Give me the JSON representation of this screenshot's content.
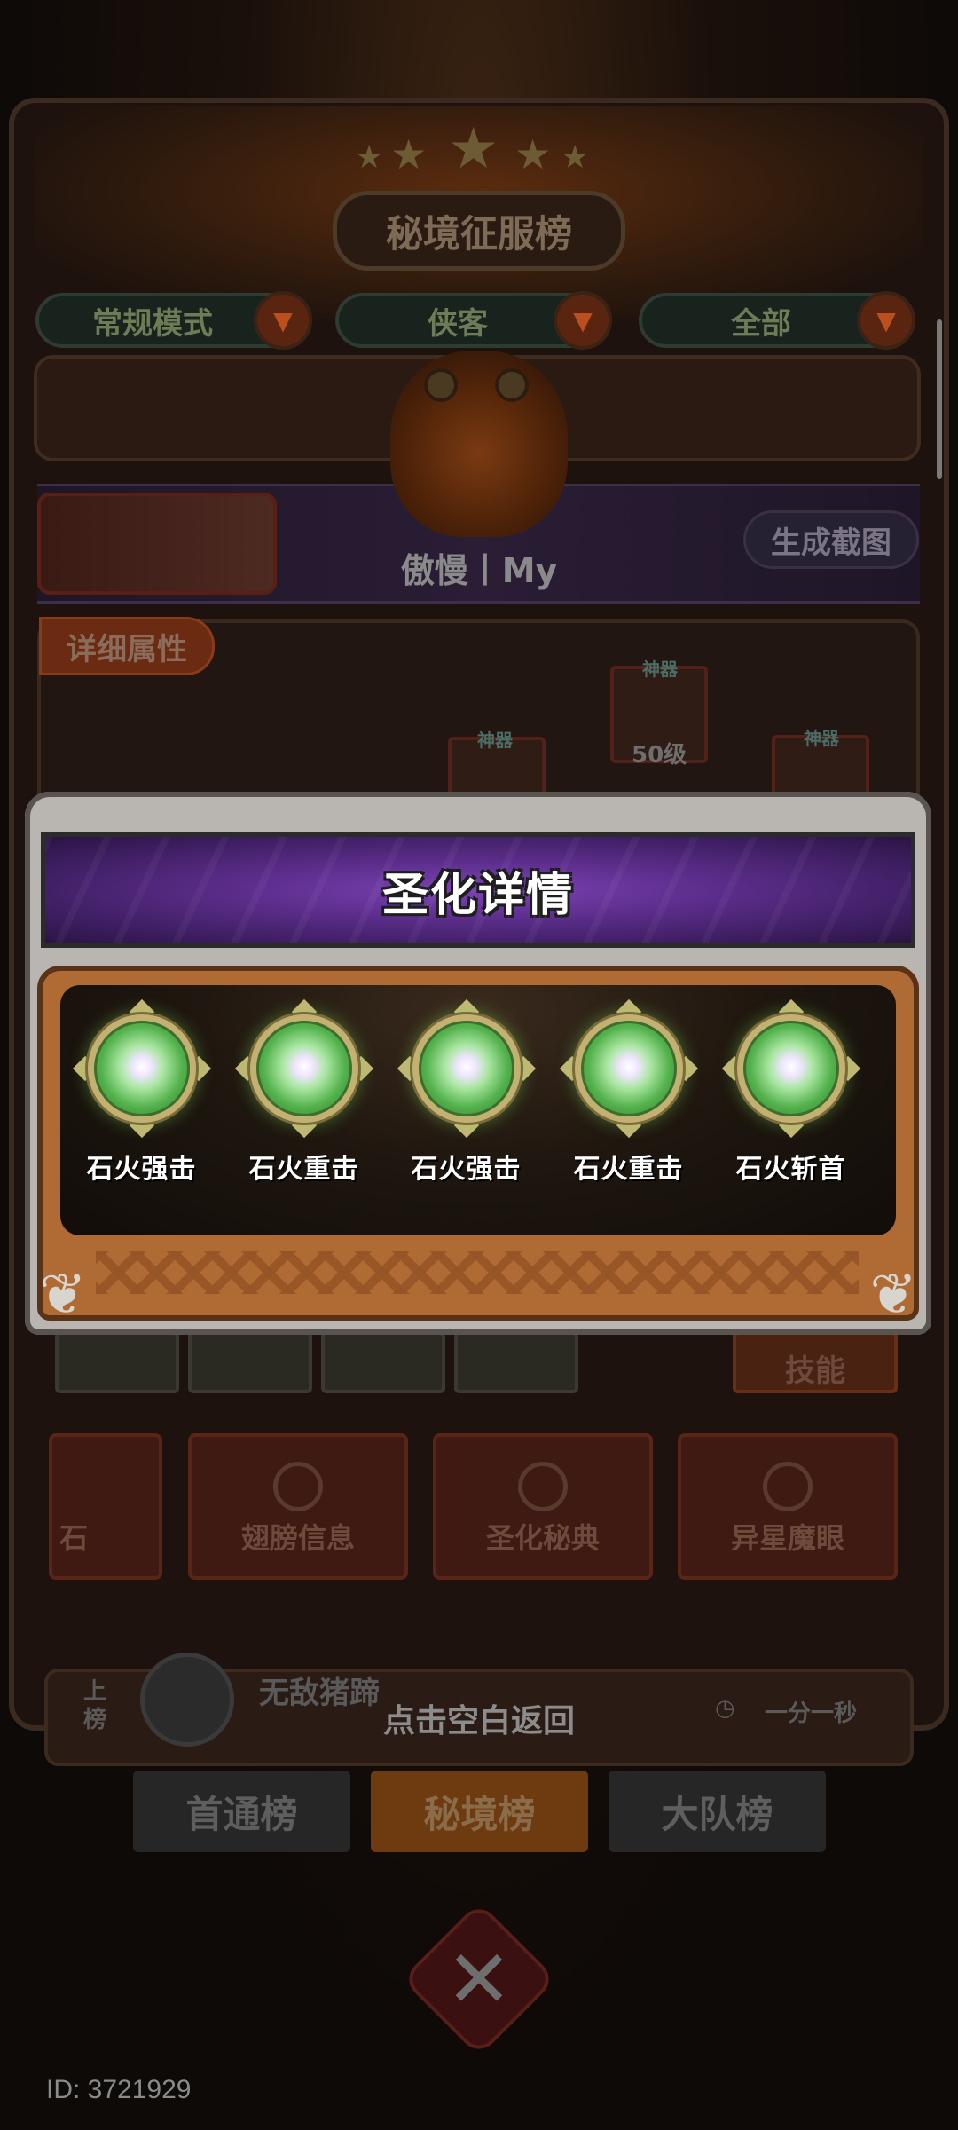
{
  "background": {
    "title": "秘境征服榜",
    "filters": [
      {
        "label": "常规模式"
      },
      {
        "label": "侠客"
      },
      {
        "label": "全部"
      }
    ],
    "player_name": "傲慢丨My",
    "screenshot_button": "生成截图",
    "detail_tab": "详细属性",
    "equip_tag": "神器",
    "equip_level": "50级",
    "menu_partial": "石",
    "menu_buttons": [
      "翅膀信息",
      "圣化秘典",
      "异星魔眼"
    ],
    "skill_button": "技能",
    "rank_side": "上榜",
    "rank_player": "无敌猪蹄",
    "rank_time": "一分一秒",
    "tap_back_hint": "点击空白返回",
    "tabs": [
      {
        "label": "首通榜",
        "active": false
      },
      {
        "label": "秘境榜",
        "active": true
      },
      {
        "label": "大队榜",
        "active": false
      }
    ],
    "id_label": "ID: 3721929"
  },
  "modal": {
    "title": "圣化详情",
    "skills": [
      {
        "label": "石火强击",
        "icon": "green-orb-icon"
      },
      {
        "label": "石火重击",
        "icon": "green-orb-icon"
      },
      {
        "label": "石火强击",
        "icon": "green-orb-icon"
      },
      {
        "label": "石火重击",
        "icon": "green-orb-icon"
      },
      {
        "label": "石火斩首",
        "icon": "green-orb-icon"
      }
    ]
  },
  "colors": {
    "title_bar": "#5b2d8a",
    "content_frame": "#b06a33",
    "orb": "#54b24d"
  }
}
